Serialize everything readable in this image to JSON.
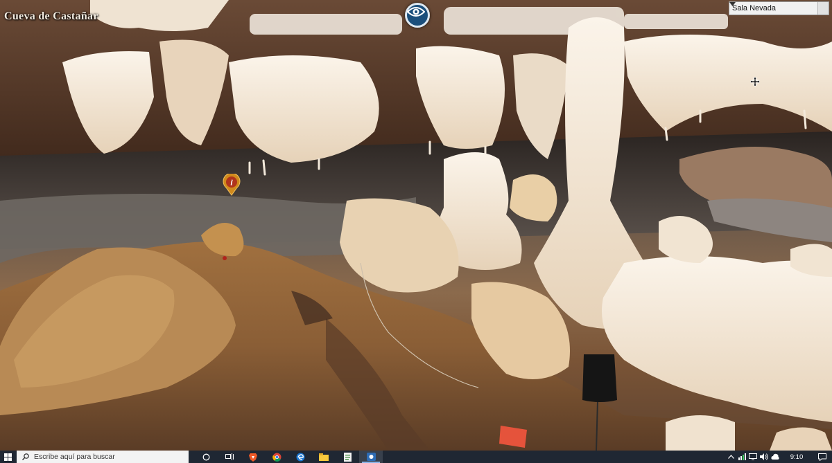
{
  "panorama": {
    "title": "Cueva de Castañar",
    "view_button_icon": "eye-icon",
    "info_hotspot_icon": "info-icon",
    "scene_selector": {
      "selected": "Sala Nevada"
    }
  },
  "taskbar": {
    "search_placeholder": "Escribe aquí para buscar",
    "pinned_icons": [
      "search-icon",
      "task-view-icon",
      "brave-icon",
      "chrome-icon",
      "edge-icon",
      "file-explorer-icon",
      "document-viewer-icon",
      "app-icon"
    ],
    "tray_icons": [
      "chevron-up-icon",
      "network-icon",
      "display-icon",
      "volume-icon",
      "cloud-icon"
    ],
    "clock": "9:10"
  },
  "colors": {
    "taskbar_bg": "#1f2733",
    "view_button": "#1b4f7c",
    "info_pin": "#d18a1c"
  }
}
